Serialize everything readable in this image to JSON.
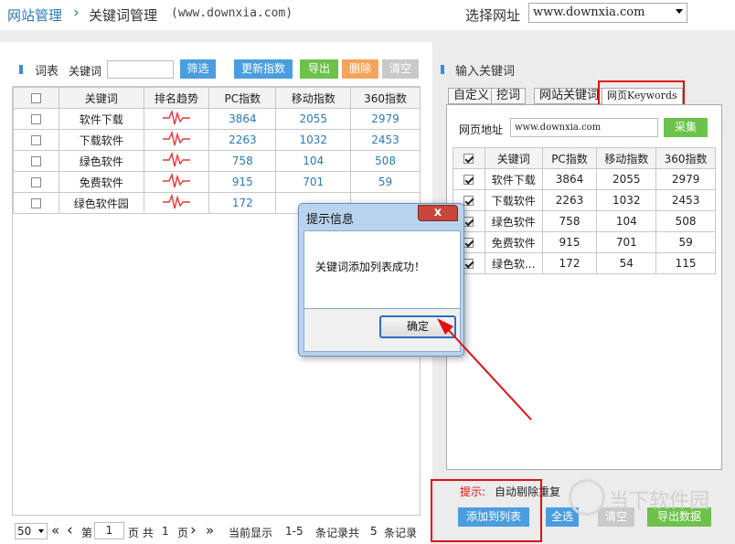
{
  "header": {
    "breadcrumb_root": "网站管理",
    "breadcrumb_sep": "›",
    "breadcrumb_current": "关键词管理",
    "breadcrumb_url": "(www.downxia.com)",
    "site_label": "选择网址",
    "site_value": "www.downxia.com"
  },
  "left": {
    "section_title": "词表",
    "keyword_label": "关键词",
    "keyword_value": "",
    "filter_btn": "筛选",
    "update_btn": "更新指数",
    "export_btn": "导出",
    "delete_btn": "删除",
    "clear_btn": "清空",
    "columns": [
      "关键词",
      "排名趋势",
      "PC指数",
      "移动指数",
      "360指数"
    ],
    "rows": [
      {
        "kw": "软件下载",
        "pc": "3864",
        "mobile": "2055",
        "s360": "2979"
      },
      {
        "kw": "下载软件",
        "pc": "2263",
        "mobile": "1032",
        "s360": "2453"
      },
      {
        "kw": "绿色软件",
        "pc": "758",
        "mobile": "104",
        "s360": "508"
      },
      {
        "kw": "免费软件",
        "pc": "915",
        "mobile": "701",
        "s360": "59"
      },
      {
        "kw": "绿色软件园",
        "pc": "172",
        "mobile": "",
        "s360": ""
      }
    ]
  },
  "pager": {
    "page_size": "50",
    "first": "«",
    "prev": "‹",
    "page_prefix": "第",
    "page_value": "1",
    "page_suffix": "页 共",
    "total_pages": "1",
    "page_unit": "页",
    "next": "›",
    "last": "»",
    "current_label": "当前显示",
    "range": "1-5",
    "records_label": "条记录共",
    "total_records": "5",
    "records_unit": "条记录"
  },
  "right": {
    "section_title": "输入关键词",
    "tabs": [
      "自定义",
      "挖词",
      "网站关键词",
      "网页Keywords"
    ],
    "url_label": "网页地址",
    "url_value": "www.downxia.com",
    "collect_btn": "采集",
    "columns": [
      "关键词",
      "PC指数",
      "移动指数",
      "360指数"
    ],
    "rows": [
      {
        "kw": "软件下载",
        "pc": "3864",
        "mobile": "2055",
        "s360": "2979"
      },
      {
        "kw": "下载软件",
        "pc": "2263",
        "mobile": "1032",
        "s360": "2453"
      },
      {
        "kw": "绿色软件",
        "pc": "758",
        "mobile": "104",
        "s360": "508"
      },
      {
        "kw": "免费软件",
        "pc": "915",
        "mobile": "701",
        "s360": "59"
      },
      {
        "kw": "绿色软...",
        "pc": "172",
        "mobile": "54",
        "s360": "115"
      }
    ],
    "hint_label": "提示:",
    "hint_text": "自动剔除重复",
    "add_btn": "添加到列表",
    "select_all_btn": "全选",
    "clear_btn": "清空",
    "export_btn": "导出数据"
  },
  "dialog": {
    "title": "提示信息",
    "close": "x",
    "message": "关键词添加列表成功！",
    "ok": "确定"
  },
  "watermark": {
    "text": "当下软件园"
  }
}
